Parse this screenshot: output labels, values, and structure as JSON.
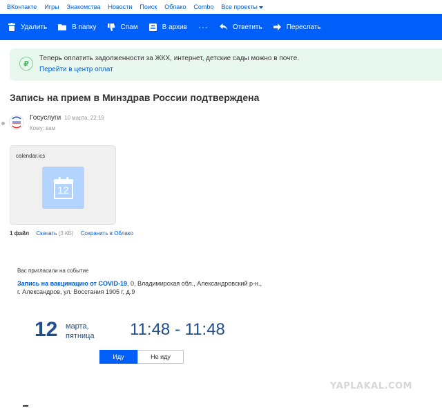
{
  "portal_nav": {
    "items": [
      "ВКонтакте",
      "Игры",
      "Знакомства",
      "Новости",
      "Поиск",
      "Облако",
      "Combo"
    ],
    "all_projects": "Все проекты"
  },
  "toolbar": {
    "delete_label": "Удалить",
    "move_label": "В папку",
    "spam_label": "Спам",
    "archive_label": "В архив",
    "more_label": "···",
    "reply_label": "Ответить",
    "forward_label": "Переслать",
    "color": "#005ff9"
  },
  "banner": {
    "icon": "ruble-icon",
    "text": "Теперь оплатить задолженности за ЖКХ, интернет, детские сады можно в почте.",
    "link": "Перейти в центр оплат"
  },
  "message": {
    "subject": "Запись на прием в Минздрав России подтверждена",
    "sender": "Госуслуги",
    "date": "10 марта, 22:19",
    "recipient": "Кому: вам"
  },
  "attachment": {
    "filename": "calendar.ics",
    "icon_day": "12",
    "files_count": "1 файл",
    "download": "Скачать",
    "size": "(3 КБ)",
    "save_to_cloud": "Сохранить в Облако"
  },
  "invitation": {
    "label": "Вас пригласили на событие",
    "event_title": "Запись на вакцинацию от COVID-19",
    "event_location": ", 0, Владимирская обл., Александровский р-н., г. Александров, ул. Восстания 1905 г, д.9",
    "day": "12",
    "month": "марта,",
    "weekday": "пятница",
    "time_range": "11:48 - 11:48",
    "accept_label": "Иду",
    "decline_label": "Не иду"
  },
  "watermark": "YAPLAKAL.COM"
}
